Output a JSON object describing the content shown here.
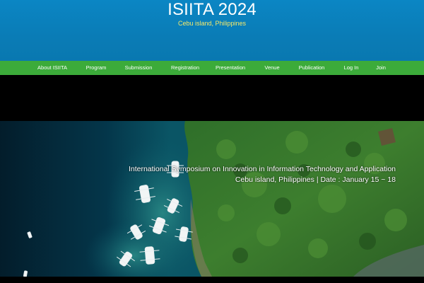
{
  "header": {
    "title": "ISIITA 2024",
    "subtitle": "Cebu island, Philippines"
  },
  "nav": {
    "items": [
      "About ISIITA",
      "Program",
      "Submission",
      "Registration",
      "Presentation",
      "Venue",
      "Publication",
      "Log In",
      "Join"
    ]
  },
  "hero": {
    "title": "International Symposium on Innovation in Information Technology and Application",
    "subtitle": "Cebu island, Philippines | Date : January 15 ~ 18"
  },
  "colors": {
    "header_bg": "#0a7cb6",
    "nav_bg": "#3cab3a",
    "subtitle_text": "#f6e96a"
  }
}
